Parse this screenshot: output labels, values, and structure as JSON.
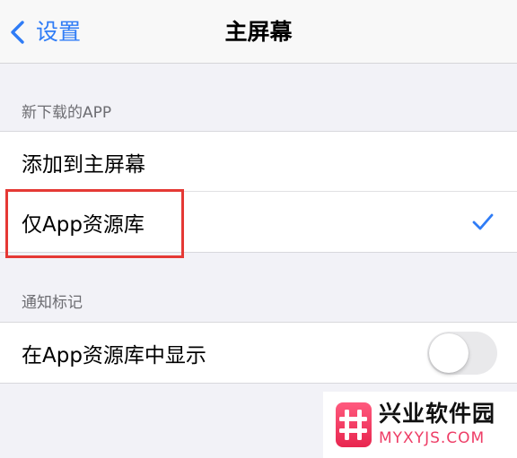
{
  "nav": {
    "back_label": "设置",
    "title": "主屏幕"
  },
  "sections": {
    "new_downloads": {
      "header": "新下载的APP",
      "items": [
        {
          "label": "添加到主屏幕"
        },
        {
          "label": "仅App资源库",
          "checked": true
        }
      ]
    },
    "badges": {
      "header": "通知标记",
      "items": [
        {
          "label": "在App资源库中显示",
          "toggle_on": false
        }
      ]
    }
  },
  "watermark": {
    "title": "兴业软件园",
    "url": "MYXYJS.COM"
  },
  "colors": {
    "accent": "#2f7cf6",
    "highlight": "#e53935",
    "background": "#f2f2f7",
    "watermark_red": "#ee3d66"
  },
  "icons": {
    "back": "chevron-left-icon",
    "selected": "checkmark-icon",
    "watermark_logo": "hash-logo-icon"
  }
}
